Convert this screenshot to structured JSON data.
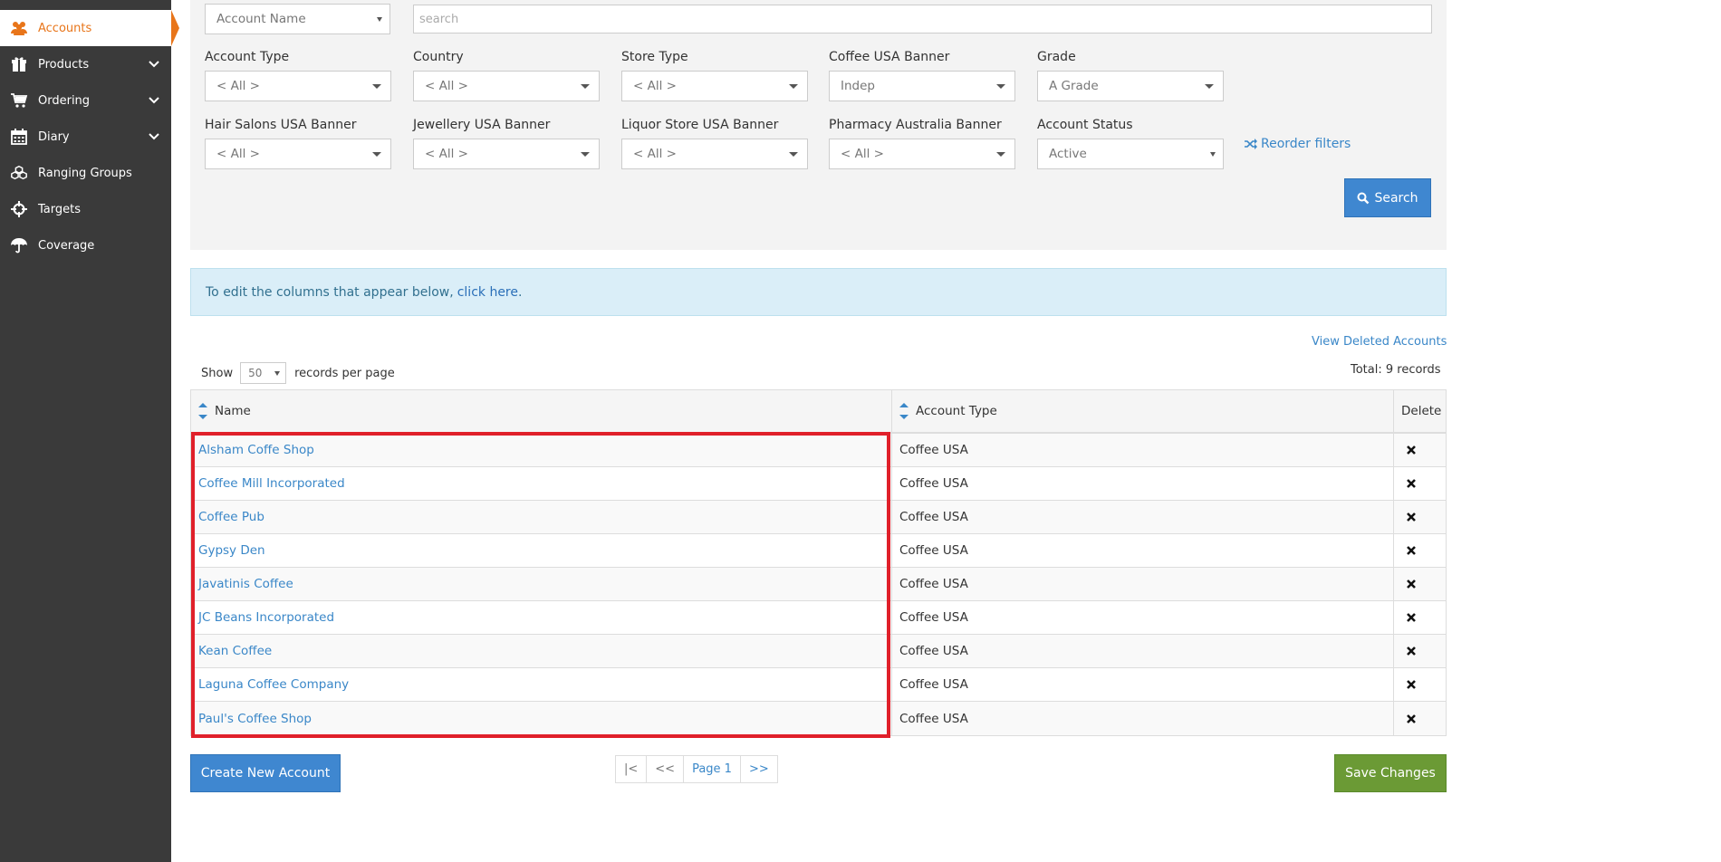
{
  "sidebar": {
    "items": [
      {
        "label": "Accounts",
        "icon": "users-icon"
      },
      {
        "label": "Products",
        "icon": "gift-icon"
      },
      {
        "label": "Ordering",
        "icon": "cart-icon"
      },
      {
        "label": "Diary",
        "icon": "calendar-icon"
      },
      {
        "label": "Ranging Groups",
        "icon": "cubes-icon"
      },
      {
        "label": "Targets",
        "icon": "crosshairs-icon"
      },
      {
        "label": "Coverage",
        "icon": "umbrella-icon"
      }
    ]
  },
  "filters": {
    "field_select": "Account Name",
    "search_placeholder": "search",
    "row1": [
      {
        "label": "Account Type",
        "value": "< All >"
      },
      {
        "label": "Country",
        "value": "< All >"
      },
      {
        "label": "Store Type",
        "value": "< All >"
      },
      {
        "label": "Coffee USA Banner",
        "value": "Indep"
      },
      {
        "label": "Grade",
        "value": "A Grade"
      }
    ],
    "row2": [
      {
        "label": "Hair Salons USA Banner",
        "value": "< All >"
      },
      {
        "label": "Jewellery USA Banner",
        "value": "< All >"
      },
      {
        "label": "Liquor Store USA Banner",
        "value": "< All >"
      },
      {
        "label": "Pharmacy Australia Banner",
        "value": "< All >"
      },
      {
        "label": "Account Status",
        "value": "Active"
      }
    ],
    "reorder_label": "Reorder filters",
    "search_button": "Search"
  },
  "info": {
    "text": "To edit the columns that appear below,",
    "link": "click here",
    "suffix": "."
  },
  "list": {
    "view_deleted": "View Deleted Accounts",
    "show_label": "Show",
    "per_page": "50",
    "per_page_suffix": "records per page",
    "total": "Total: 9 records"
  },
  "table": {
    "headers": {
      "name": "Name",
      "type": "Account Type",
      "delete": "Delete"
    },
    "rows": [
      {
        "name": "Alsham Coffe Shop",
        "type": "Coffee USA"
      },
      {
        "name": "Coffee Mill Incorporated",
        "type": "Coffee USA"
      },
      {
        "name": "Coffee Pub",
        "type": "Coffee USA"
      },
      {
        "name": "Gypsy Den",
        "type": "Coffee USA"
      },
      {
        "name": "Javatinis Coffee",
        "type": "Coffee USA"
      },
      {
        "name": "JC Beans Incorporated",
        "type": "Coffee USA"
      },
      {
        "name": "Kean Coffee",
        "type": "Coffee USA"
      },
      {
        "name": "Laguna Coffee Company",
        "type": "Coffee USA"
      },
      {
        "name": "Paul's Coffee Shop",
        "type": "Coffee USA"
      }
    ]
  },
  "footer": {
    "create_button": "Create New Account",
    "pager": {
      "first": "|<",
      "prev": "<<",
      "page": "Page 1",
      "next": ">>"
    },
    "save_button": "Save Changes"
  },
  "colors": {
    "accent": "#e8751a",
    "primary": "#3f87d0",
    "success": "#6b9a35",
    "highlight": "#e0202a"
  }
}
